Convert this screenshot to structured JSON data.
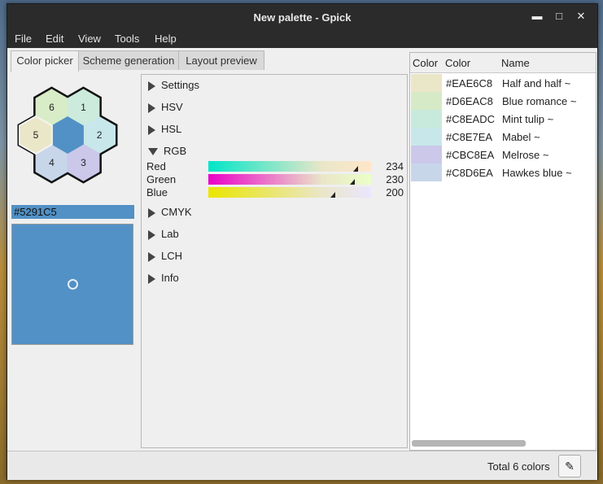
{
  "window": {
    "title": "New palette - Gpick"
  },
  "menu": [
    "File",
    "Edit",
    "View",
    "Tools",
    "Help"
  ],
  "tabs": [
    "Color picker",
    "Scheme generation",
    "Layout preview"
  ],
  "hexes": [
    {
      "label": "6",
      "color": "#d8ecc8"
    },
    {
      "label": "1",
      "color": "#cdebdc"
    },
    {
      "label": "5",
      "color": "#eae6c8"
    },
    {
      "label": "2",
      "color": "#c8e7ea"
    },
    {
      "label": "4",
      "color": "#c8d6ea"
    },
    {
      "label": "3",
      "color": "#cbc8ea"
    }
  ],
  "center_color": "#5291c5",
  "current_hex": "#5291C5",
  "sections": [
    "Settings",
    "HSV",
    "HSL",
    "RGB",
    "CMYK",
    "Lab",
    "LCH",
    "Info"
  ],
  "rgb": [
    {
      "label": "Red",
      "value": "234",
      "fraction": 0.92
    },
    {
      "label": "Green",
      "value": "230",
      "fraction": 0.9
    },
    {
      "label": "Blue",
      "value": "200",
      "fraction": 0.78
    }
  ],
  "palette_headers": [
    "Color",
    "Color",
    "Name"
  ],
  "palette": [
    {
      "hex": "#EAE6C8",
      "name": "Half and half ~",
      "color": "#eae6c8"
    },
    {
      "hex": "#D6EAC8",
      "name": "Blue romance ~",
      "color": "#d6eac8"
    },
    {
      "hex": "#C8EADC",
      "name": "Mint tulip ~",
      "color": "#c8eadc"
    },
    {
      "hex": "#C8E7EA",
      "name": "Mabel ~",
      "color": "#c8e7ea"
    },
    {
      "hex": "#CBC8EA",
      "name": "Melrose ~",
      "color": "#cbc8ea"
    },
    {
      "hex": "#C8D6EA",
      "name": "Hawkes blue ~",
      "color": "#c8d6ea"
    }
  ],
  "status": "Total 6 colors",
  "icons": {
    "pick_button": "eyedropper-icon"
  }
}
